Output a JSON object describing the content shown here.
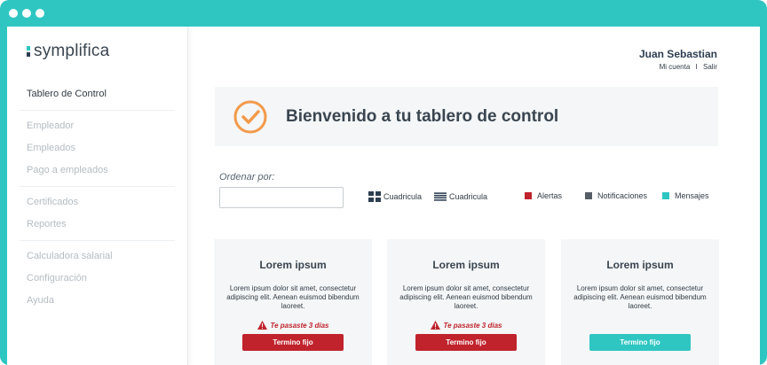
{
  "colors": {
    "frame": "#2fc6c2",
    "accent_teal": "#2fc6c2",
    "alert_red": "#c0232c",
    "notification_gray": "#555e66",
    "check_orange": "#f29a4a"
  },
  "brand": {
    "logo_text": "symplifica"
  },
  "sidebar": {
    "groups": [
      [
        {
          "label": "Tablero de Control",
          "active": true
        }
      ],
      [
        {
          "label": "Empleador"
        },
        {
          "label": "Empleados"
        },
        {
          "label": "Pago a empleados"
        }
      ],
      [
        {
          "label": "Certificados"
        },
        {
          "label": "Reportes"
        }
      ],
      [
        {
          "label": "Calculadora salarial"
        },
        {
          "label": "Configuración"
        },
        {
          "label": "Ayuda"
        }
      ]
    ]
  },
  "header": {
    "user_name": "Juan Sebastian",
    "my_account": "Mi cuenta",
    "separator": "I",
    "logout": "Salir"
  },
  "welcome": {
    "icon": "check-circle-icon",
    "title": "Bienvenido a tu tablero de control"
  },
  "toolbar": {
    "sort_label": "Ordenar por:",
    "sort_value": "",
    "view_grid_label": "Cuadricula",
    "view_list_label": "Cuadricula",
    "legend": [
      {
        "label": "Alertas",
        "color": "#c0232c"
      },
      {
        "label": "Notificaciones",
        "color": "#555e66"
      },
      {
        "label": "Mensajes",
        "color": "#2fc6c2"
      }
    ]
  },
  "cards": [
    {
      "title": "Lorem ipsum",
      "body": "Lorem ipsum dolor sit amet, consectetur adipiscing elit. Aenean euismod bibendum laoreet.",
      "warning": "Te pasaste 3 días",
      "button": "Termino fijo",
      "status": "alert"
    },
    {
      "title": "Lorem ipsum",
      "body": "Lorem ipsum dolor sit amet, consectetur adipiscing elit. Aenean euismod bibendum laoreet.",
      "warning": "Te pasaste 3 días",
      "button": "Termino fijo",
      "status": "alert"
    },
    {
      "title": "Lorem ipsum",
      "body": "Lorem ipsum dolor sit amet, consectetur adipiscing elit. Aenean euismod bibendum laoreet.",
      "warning": "",
      "button": "Termino fijo",
      "status": "ok"
    }
  ]
}
